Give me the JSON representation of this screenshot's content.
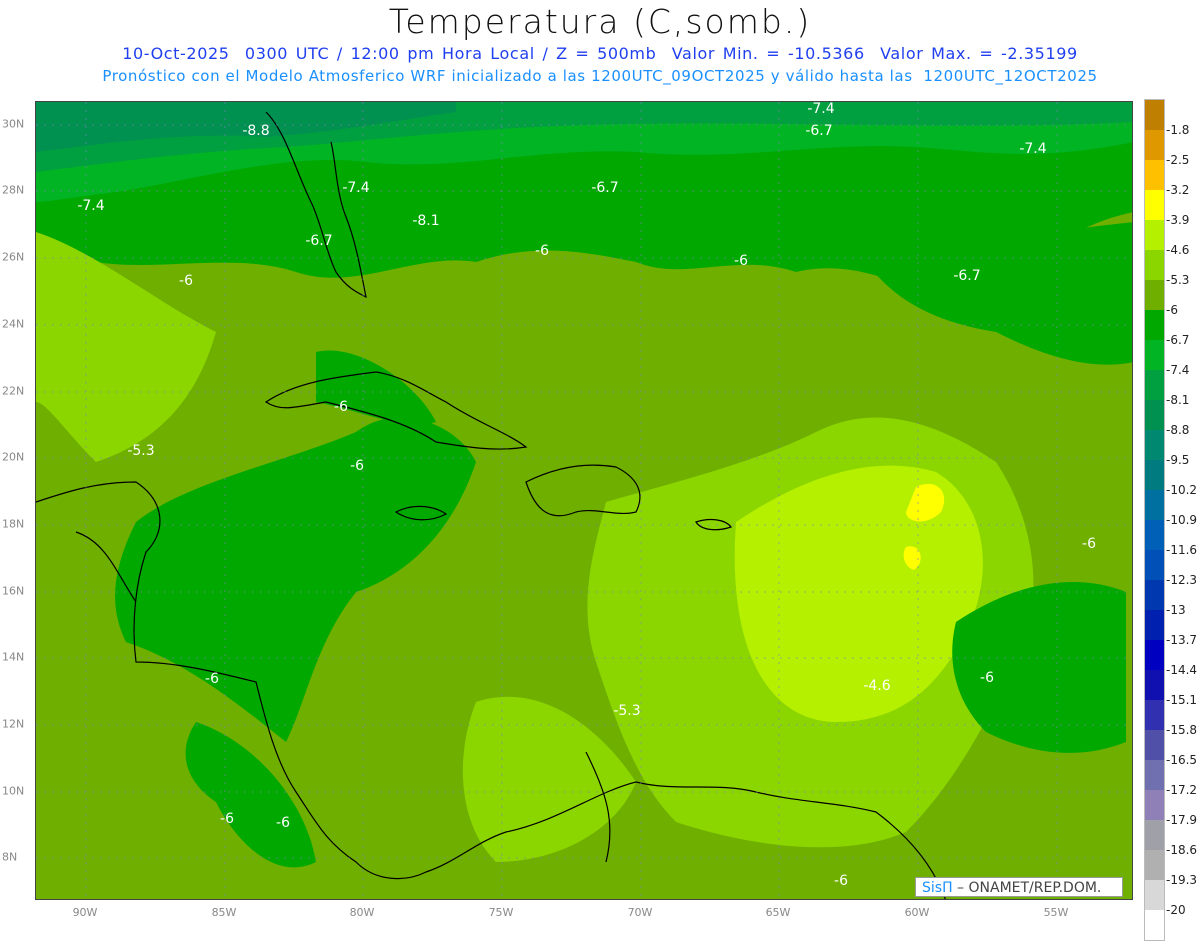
{
  "header": {
    "title": "Temperatura (C,somb.)",
    "subtitle_line1": "10-Oct-2025  0300 UTC / 12:00 pm Hora Local / Z = 500mb  Valor Min. = -10.5366  Valor Max. = -2.35199",
    "subtitle_line2": "Pronóstico con el Modelo Atmosferico WRF inicializado a las 1200UTC_09OCT2025 y válido hasta las  1200UTC_12OCT2025"
  },
  "axes": {
    "lat_labels": [
      "30N",
      "28N",
      "26N",
      "24N",
      "22N",
      "20N",
      "18N",
      "16N",
      "14N",
      "12N",
      "10N",
      "8N"
    ],
    "lon_labels": [
      "90W",
      "85W",
      "80W",
      "75W",
      "70W",
      "65W",
      "60W",
      "55W"
    ]
  },
  "map": {
    "contour_labels": [
      "-7.4",
      "-8.8",
      "-6.7",
      "-7.4",
      "-7.4",
      "-6.7",
      "-7.4",
      "-8.1",
      "-6.7",
      "-6",
      "-6",
      "-6",
      "-6.7",
      "-6",
      "-5.3",
      "-6",
      "-6",
      "-4.6",
      "-6",
      "-6",
      "-5.3",
      "-6",
      "-6",
      "-6"
    ]
  },
  "credit": {
    "brand": "SisΠ",
    "text": " –  ONAMET/REP.DOM."
  },
  "colorbar": {
    "labels": [
      "-1.8",
      "-2.5",
      "-3.2",
      "-3.9",
      "-4.6",
      "-5.3",
      "-6",
      "-6.7",
      "-7.4",
      "-8.1",
      "-8.8",
      "-9.5",
      "-10.2",
      "-10.9",
      "-11.6",
      "-12.3",
      "-13",
      "-13.7",
      "-14.4",
      "-15.1",
      "-15.8",
      "-16.5",
      "-17.2",
      "-17.9",
      "-18.6",
      "-19.3",
      "-20"
    ],
    "colors": [
      "#bf7f00",
      "#e09800",
      "#ffc000",
      "#ffff00",
      "#b4f000",
      "#8cd600",
      "#6eaf00",
      "#00a800",
      "#00b424",
      "#00a040",
      "#009050",
      "#008870",
      "#007c80",
      "#0070a0",
      "#0060b8",
      "#0050b8",
      "#0038b0",
      "#0020b0",
      "#0000c0",
      "#1010b0",
      "#3030b0",
      "#5050a8",
      "#7070b0",
      "#9080b8",
      "#a0a0a8",
      "#b0b0b0",
      "#d8d8d8",
      "#ffffff"
    ]
  }
}
